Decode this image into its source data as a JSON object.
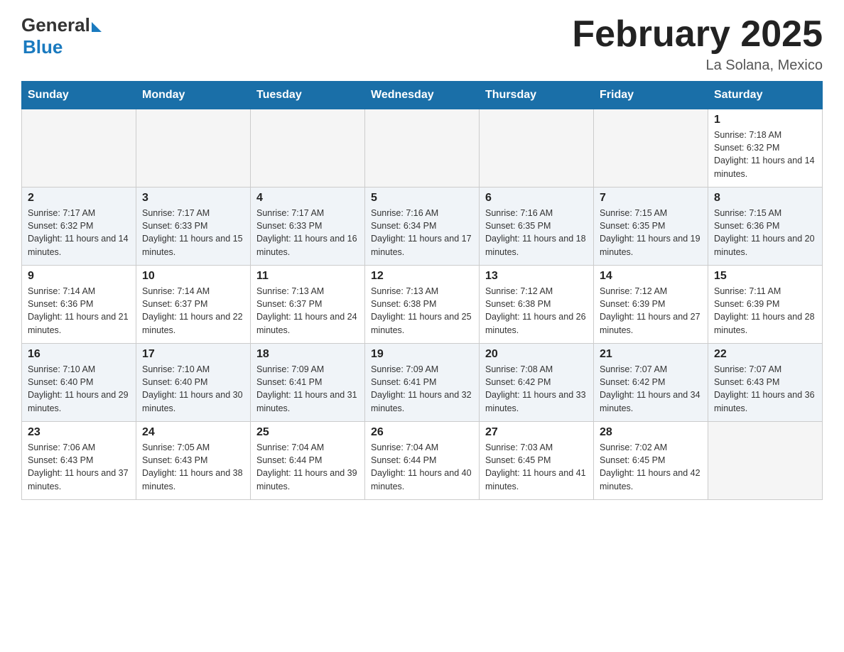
{
  "header": {
    "logo_general": "General",
    "logo_blue": "Blue",
    "month_title": "February 2025",
    "location": "La Solana, Mexico"
  },
  "days_of_week": [
    "Sunday",
    "Monday",
    "Tuesday",
    "Wednesday",
    "Thursday",
    "Friday",
    "Saturday"
  ],
  "weeks": [
    [
      {
        "day": "",
        "info": ""
      },
      {
        "day": "",
        "info": ""
      },
      {
        "day": "",
        "info": ""
      },
      {
        "day": "",
        "info": ""
      },
      {
        "day": "",
        "info": ""
      },
      {
        "day": "",
        "info": ""
      },
      {
        "day": "1",
        "info": "Sunrise: 7:18 AM\nSunset: 6:32 PM\nDaylight: 11 hours and 14 minutes."
      }
    ],
    [
      {
        "day": "2",
        "info": "Sunrise: 7:17 AM\nSunset: 6:32 PM\nDaylight: 11 hours and 14 minutes."
      },
      {
        "day": "3",
        "info": "Sunrise: 7:17 AM\nSunset: 6:33 PM\nDaylight: 11 hours and 15 minutes."
      },
      {
        "day": "4",
        "info": "Sunrise: 7:17 AM\nSunset: 6:33 PM\nDaylight: 11 hours and 16 minutes."
      },
      {
        "day": "5",
        "info": "Sunrise: 7:16 AM\nSunset: 6:34 PM\nDaylight: 11 hours and 17 minutes."
      },
      {
        "day": "6",
        "info": "Sunrise: 7:16 AM\nSunset: 6:35 PM\nDaylight: 11 hours and 18 minutes."
      },
      {
        "day": "7",
        "info": "Sunrise: 7:15 AM\nSunset: 6:35 PM\nDaylight: 11 hours and 19 minutes."
      },
      {
        "day": "8",
        "info": "Sunrise: 7:15 AM\nSunset: 6:36 PM\nDaylight: 11 hours and 20 minutes."
      }
    ],
    [
      {
        "day": "9",
        "info": "Sunrise: 7:14 AM\nSunset: 6:36 PM\nDaylight: 11 hours and 21 minutes."
      },
      {
        "day": "10",
        "info": "Sunrise: 7:14 AM\nSunset: 6:37 PM\nDaylight: 11 hours and 22 minutes."
      },
      {
        "day": "11",
        "info": "Sunrise: 7:13 AM\nSunset: 6:37 PM\nDaylight: 11 hours and 24 minutes."
      },
      {
        "day": "12",
        "info": "Sunrise: 7:13 AM\nSunset: 6:38 PM\nDaylight: 11 hours and 25 minutes."
      },
      {
        "day": "13",
        "info": "Sunrise: 7:12 AM\nSunset: 6:38 PM\nDaylight: 11 hours and 26 minutes."
      },
      {
        "day": "14",
        "info": "Sunrise: 7:12 AM\nSunset: 6:39 PM\nDaylight: 11 hours and 27 minutes."
      },
      {
        "day": "15",
        "info": "Sunrise: 7:11 AM\nSunset: 6:39 PM\nDaylight: 11 hours and 28 minutes."
      }
    ],
    [
      {
        "day": "16",
        "info": "Sunrise: 7:10 AM\nSunset: 6:40 PM\nDaylight: 11 hours and 29 minutes."
      },
      {
        "day": "17",
        "info": "Sunrise: 7:10 AM\nSunset: 6:40 PM\nDaylight: 11 hours and 30 minutes."
      },
      {
        "day": "18",
        "info": "Sunrise: 7:09 AM\nSunset: 6:41 PM\nDaylight: 11 hours and 31 minutes."
      },
      {
        "day": "19",
        "info": "Sunrise: 7:09 AM\nSunset: 6:41 PM\nDaylight: 11 hours and 32 minutes."
      },
      {
        "day": "20",
        "info": "Sunrise: 7:08 AM\nSunset: 6:42 PM\nDaylight: 11 hours and 33 minutes."
      },
      {
        "day": "21",
        "info": "Sunrise: 7:07 AM\nSunset: 6:42 PM\nDaylight: 11 hours and 34 minutes."
      },
      {
        "day": "22",
        "info": "Sunrise: 7:07 AM\nSunset: 6:43 PM\nDaylight: 11 hours and 36 minutes."
      }
    ],
    [
      {
        "day": "23",
        "info": "Sunrise: 7:06 AM\nSunset: 6:43 PM\nDaylight: 11 hours and 37 minutes."
      },
      {
        "day": "24",
        "info": "Sunrise: 7:05 AM\nSunset: 6:43 PM\nDaylight: 11 hours and 38 minutes."
      },
      {
        "day": "25",
        "info": "Sunrise: 7:04 AM\nSunset: 6:44 PM\nDaylight: 11 hours and 39 minutes."
      },
      {
        "day": "26",
        "info": "Sunrise: 7:04 AM\nSunset: 6:44 PM\nDaylight: 11 hours and 40 minutes."
      },
      {
        "day": "27",
        "info": "Sunrise: 7:03 AM\nSunset: 6:45 PM\nDaylight: 11 hours and 41 minutes."
      },
      {
        "day": "28",
        "info": "Sunrise: 7:02 AM\nSunset: 6:45 PM\nDaylight: 11 hours and 42 minutes."
      },
      {
        "day": "",
        "info": ""
      }
    ]
  ]
}
